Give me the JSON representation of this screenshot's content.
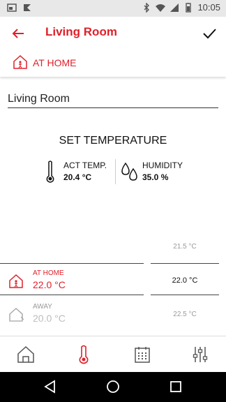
{
  "statusbar": {
    "time": "10:05"
  },
  "appbar": {
    "title": "Living Room"
  },
  "mode": {
    "label": "AT HOME"
  },
  "room_name": {
    "value": "Living Room"
  },
  "set_temperature": {
    "heading": "SET TEMPERATURE"
  },
  "actual_temp": {
    "label": "ACT TEMP.",
    "value": "20.4 °C"
  },
  "humidity": {
    "label": "HUMIDITY",
    "value": "35.0 %"
  },
  "right_temps": {
    "upper": "21.5 °C",
    "selected": "22.0 °C",
    "lower": "22.5 °C"
  },
  "modes": [
    {
      "label": "AT HOME",
      "value": "22.0 °C"
    },
    {
      "label": "AWAY",
      "value": "20.0 °C"
    }
  ],
  "colors": {
    "accent": "#e0202a",
    "muted": "#aaaaaa"
  }
}
